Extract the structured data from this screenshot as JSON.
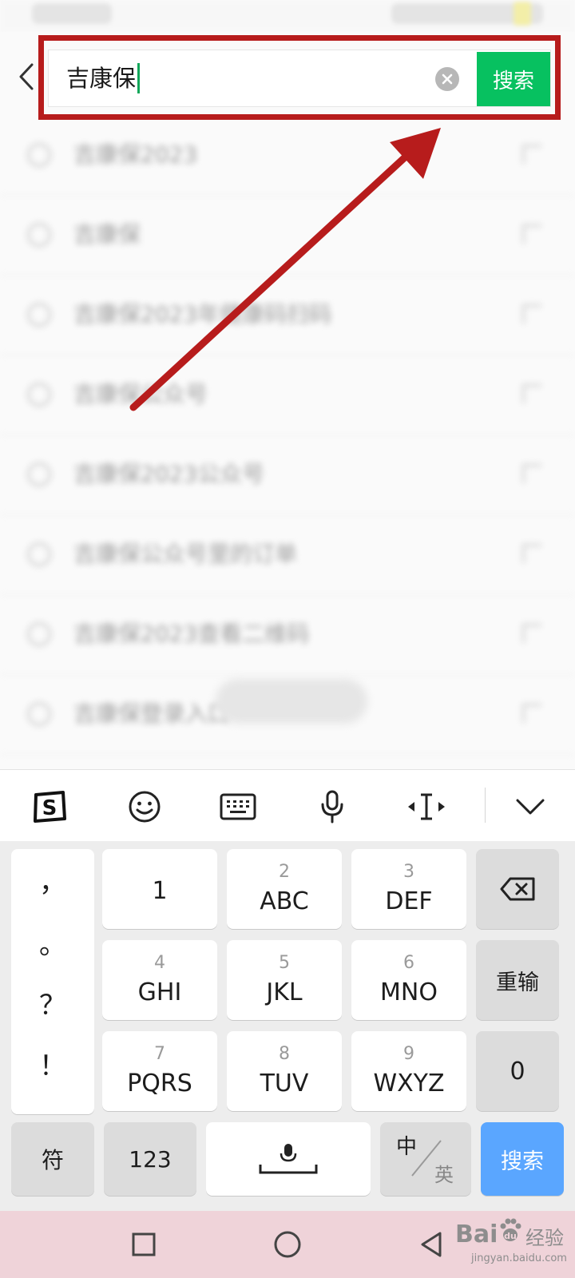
{
  "search": {
    "query": "吉康保",
    "button_label": "搜索"
  },
  "suggestions": [
    "吉康保2023",
    "吉康保",
    "吉康保2023年健康码扫码",
    "吉康保公众号",
    "吉康保2023公众号",
    "吉康保公众号里的订单",
    "吉康保2023查看二维码",
    "吉康保登录入口"
  ],
  "keyboard": {
    "toolbar_icons": [
      "sogou-logo-icon",
      "emoji-icon",
      "keyboard-icon",
      "microphone-icon",
      "cursor-move-icon",
      "collapse-keyboard-icon"
    ],
    "punctuation": [
      "，",
      "。",
      "？",
      "！"
    ],
    "keys": [
      {
        "num": "",
        "letters": "1"
      },
      {
        "num": "2",
        "letters": "ABC"
      },
      {
        "num": "3",
        "letters": "DEF"
      },
      {
        "num": "4",
        "letters": "GHI"
      },
      {
        "num": "5",
        "letters": "JKL"
      },
      {
        "num": "6",
        "letters": "MNO"
      },
      {
        "num": "7",
        "letters": "PQRS"
      },
      {
        "num": "8",
        "letters": "TUV"
      },
      {
        "num": "9",
        "letters": "WXYZ"
      }
    ],
    "reinput_label": "重输",
    "zero_label": "0",
    "symbol_label": "符",
    "numeric_label": "123",
    "lang_zh": "中",
    "lang_en": "英",
    "enter_label": "搜索"
  },
  "colors": {
    "accent_green": "#07c160",
    "annotation_red": "#b71c1c",
    "enter_blue": "#5aa6ff"
  },
  "watermark": {
    "brand": "Bai",
    "brand_suffix": "经验",
    "url": "jingyan.baidu.com"
  }
}
